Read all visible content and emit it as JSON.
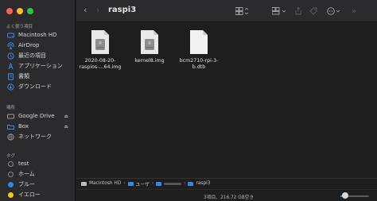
{
  "sidebar": {
    "favorites_title": "よく使う項目",
    "favorites": [
      {
        "label": "Macintosh HD",
        "icon": "hard-drive-icon"
      },
      {
        "label": "AirDrop",
        "icon": "airdrop-icon"
      },
      {
        "label": "最近の項目",
        "icon": "clock-icon"
      },
      {
        "label": "アプリケーション",
        "icon": "applications-icon"
      },
      {
        "label": "書類",
        "icon": "document-icon"
      },
      {
        "label": "ダウンロード",
        "icon": "download-icon"
      }
    ],
    "locations_title": "場所",
    "locations": [
      {
        "label": "Google Drive",
        "icon": "drive-icon"
      },
      {
        "label": "Box",
        "icon": "folder-icon"
      },
      {
        "label": "ネットワーク",
        "icon": "network-icon"
      }
    ],
    "tags_title": "タグ",
    "tags": [
      {
        "label": "test",
        "color": "#2b2a2c"
      },
      {
        "label": "ホーム",
        "color": "#2b2a2c"
      },
      {
        "label": "ブルー",
        "color": "#2d8be5"
      },
      {
        "label": "イエロー",
        "color": "#f5c518"
      }
    ]
  },
  "toolbar": {
    "title": "raspi3"
  },
  "files": [
    {
      "name_line1": "2020-08-20-",
      "name_line2": "raspios-...64.img",
      "type": "disk-image"
    },
    {
      "name_line1": "kernel8.img",
      "name_line2": "",
      "type": "disk-image"
    },
    {
      "name_line1": "bcm2710-rpi-3-",
      "name_line2": "b.dtb",
      "type": "document"
    }
  ],
  "pathbar": {
    "items": [
      "Macintosh HD",
      "ユーザ",
      "raspi3"
    ]
  },
  "status": {
    "text": "3項目、216.72 GB空き"
  },
  "colors": {
    "accent": "#2d8be5",
    "window_bg": "#1e1e1e",
    "sidebar_bg": "#2b2a2c"
  }
}
